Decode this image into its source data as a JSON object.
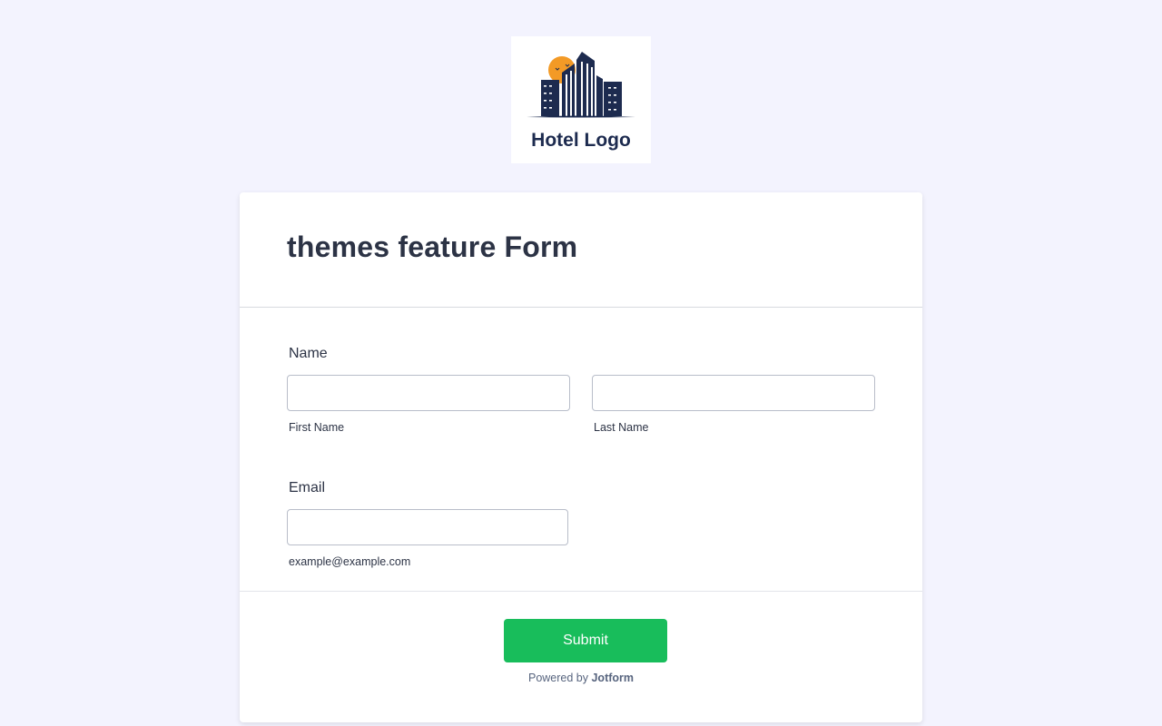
{
  "logo": {
    "text": "Hotel Logo",
    "colors": {
      "navy": "#1d2b4f",
      "sun": "#f39a26"
    }
  },
  "form": {
    "title": "themes feature Form",
    "name_field": {
      "label": "Name",
      "first_sublabel": "First Name",
      "last_sublabel": "Last Name",
      "first_value": "",
      "last_value": ""
    },
    "email_field": {
      "label": "Email",
      "sublabel": "example@example.com",
      "value": ""
    },
    "submit_label": "Submit",
    "powered_prefix": "Powered by",
    "powered_brand": "Jotform"
  },
  "colors": {
    "page_bg": "#f3f3fe",
    "submit_bg": "#18bd5b",
    "text": "#2c3345"
  }
}
